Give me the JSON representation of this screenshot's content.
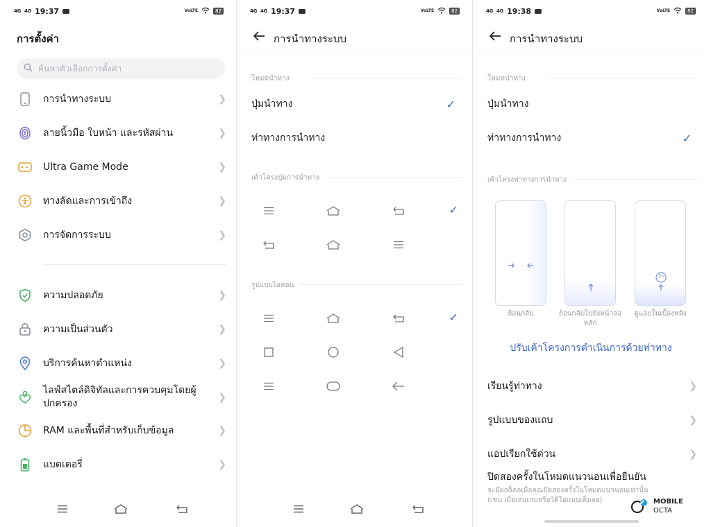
{
  "panel1": {
    "status": {
      "signal1": "4G",
      "signal2": "4G",
      "time": "19:37",
      "volte": "VoLTE",
      "battery": "82"
    },
    "title": "การตั้งค่า",
    "search_placeholder": "ค้นหาตัวเลือกการตั้งค่า",
    "items": [
      {
        "label": "การนำทางระบบ",
        "icon": "phone-icon",
        "color": "#8a8f9c"
      },
      {
        "label": "ลายนิ้วมือ ใบหน้า และรหัสผ่าน",
        "icon": "fingerprint-icon",
        "color": "#7b72d6"
      },
      {
        "label": "Ultra Game Mode",
        "icon": "gamepad-icon",
        "color": "#e4a33a"
      },
      {
        "label": "ทางลัดและการเข้าถึง",
        "icon": "accessibility-icon",
        "color": "#e4a33a"
      },
      {
        "label": "การจัดการระบบ",
        "icon": "hexagon-gear-icon",
        "color": "#8a8f9c"
      },
      {
        "label": "ความปลอดภัย",
        "icon": "shield-icon",
        "color": "#4caf6a"
      },
      {
        "label": "ความเป็นส่วนตัว",
        "icon": "lock-icon",
        "color": "#8a8f9c"
      },
      {
        "label": "บริการค้นหาตำแหน่ง",
        "icon": "location-pin-icon",
        "color": "#4a7ad6"
      },
      {
        "label": "ไลฟ์สไตล์ดิจิทัลและการควบคุมโดยผู้ปกครอง",
        "icon": "heart-person-icon",
        "color": "#4caf6a"
      },
      {
        "label": "RAM และพื้นที่สำหรับเก็บข้อมูล",
        "icon": "pie-chart-icon",
        "color": "#e4a33a"
      },
      {
        "label": "แบตเตอรี่",
        "icon": "battery-icon",
        "color": "#4caf6a"
      }
    ]
  },
  "panel2": {
    "status": {
      "signal1": "4G",
      "signal2": "4G",
      "time": "19:37",
      "volte": "VoLTE",
      "battery": "82"
    },
    "title": "การนำทางระบบ",
    "mode_header": "โหมดนำทาง",
    "options": [
      {
        "label": "ปุ่มนำทาง",
        "checked": true
      },
      {
        "label": "ท่าทางการนำทาง",
        "checked": false
      }
    ],
    "layout_header": "เค้าโครงปุ่มการนำทาง",
    "icon_style_header": "รูปแบบไอคอน"
  },
  "panel3": {
    "status": {
      "signal1": "4G",
      "signal2": "4G",
      "time": "19:38",
      "volte": "VoLTE",
      "battery": "82"
    },
    "title": "การนำทางระบบ",
    "mode_header": "โหมดนำทาง",
    "options": [
      {
        "label": "ปุ่มนำทาง",
        "checked": false
      },
      {
        "label": "ท่าทางการนำทาง",
        "checked": true
      }
    ],
    "gesture_header": "เค้าโครงท่าทางการนำทาง",
    "captions": [
      "ย้อนกลับ",
      "ย้อนกลับไปยังหน้าจอหลัก",
      "ดูแอปในเบื้องหลัง"
    ],
    "hold_badge": "2s",
    "link": "ปรับเค้าโครงการดำเนินการด้วยท่าทาง",
    "rows": [
      "เรียนรู้ท่าทาง",
      "รูปแบบของแถบ",
      "แอปเรียกใช้ด่วน"
    ],
    "double_tap_title": "ปิดสองครั้งในโหมดแนวนอนเพื่อยืนยัน",
    "double_tap_desc": "จะมีผลก็ต่อเมื่อคุณปัดสองครั้งในโหมดแนวนอนเท่านั้น (เช่น เมื่อเล่นเกมหรือวิดีโอแบบเต็มจอ)"
  },
  "watermark": {
    "line1": "MOBILE",
    "line2": "OCTA"
  },
  "colors": {
    "accent": "#3a64c8",
    "chevron": "#c0c0c0",
    "section": "#a3a3a3"
  }
}
